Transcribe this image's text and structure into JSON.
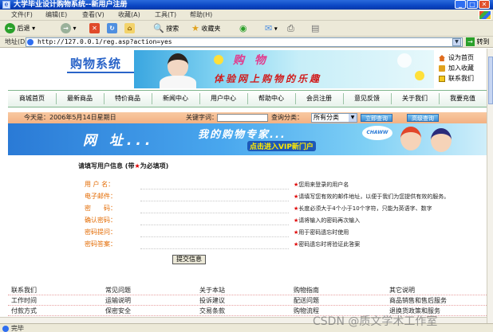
{
  "window": {
    "title": "大学毕业设计购物系统--新用户注册",
    "minimize": "_",
    "maximize": "□",
    "close": "✕"
  },
  "menubar": [
    "文件(F)",
    "编辑(E)",
    "查看(V)",
    "收藏(A)",
    "工具(T)",
    "帮助(H)"
  ],
  "toolbar": {
    "back": "后退",
    "search": "搜索",
    "favorites": "收藏夹"
  },
  "address": {
    "label": "地址(D)",
    "url": "http://127.0.0.1/reg.asp?action=yes",
    "go": "转到"
  },
  "site": {
    "logo": "购物系统",
    "banner_title": "购 物",
    "banner_subtitle": "体验网上购物的乐趣",
    "quicklinks": [
      "设为首页",
      "加入收藏",
      "联系我们"
    ]
  },
  "nav": [
    "商城首页",
    "最新商品",
    "特价商品",
    "新闻中心",
    "用户中心",
    "帮助中心",
    "会员注册",
    "意见反馈",
    "关于我们",
    "我要充值"
  ],
  "searchbar": {
    "date": "今天是：2006年5月14日星期日",
    "keyword_label": "关键字词：",
    "category_label": "查询分类：",
    "category_selected": "所有分类",
    "btn_search": "立即查询",
    "btn_advanced": "高级查询"
  },
  "banner2": {
    "net": "网 址...",
    "title": "我的购物专家...",
    "sub": "点击进入VIP新门户",
    "bubble": "CHAWW"
  },
  "form": {
    "title_prefix": "请填写用户信息 (带",
    "title_star": "★",
    "title_suffix": "为必填项)",
    "rows": [
      {
        "label": "用 户 名：",
        "hint": "您用来登录的用户名"
      },
      {
        "label": "电子邮件：",
        "hint": "请填写您有效的邮件地址，以便于我们为您提供有效的服务。"
      },
      {
        "label": "密　　码：",
        "hint": "长度必须大于4个小于10个字符，只能为英语字、数字"
      },
      {
        "label": "确认密码：",
        "hint": "请将输入的密码再次输入"
      },
      {
        "label": "密码提问：",
        "hint": "用于密码遗忘时使用"
      },
      {
        "label": "密码答案：",
        "hint": "密码遗忘时将验证此答案"
      }
    ],
    "star": "★",
    "submit": "提交信息"
  },
  "footer": {
    "rows": [
      [
        "联系我们",
        "常见问题",
        "关于本站",
        "购物指南",
        "其它说明"
      ],
      [
        "工作时间",
        "运输说明",
        "投诉建议",
        "配送问题",
        "商品销售和售后服务"
      ],
      [
        "付款方式",
        "保密安全",
        "交易条款",
        "购物流程",
        "退换货政策和服务"
      ]
    ]
  },
  "status": "完毕",
  "watermark": "CSDN @质文学术工作室"
}
